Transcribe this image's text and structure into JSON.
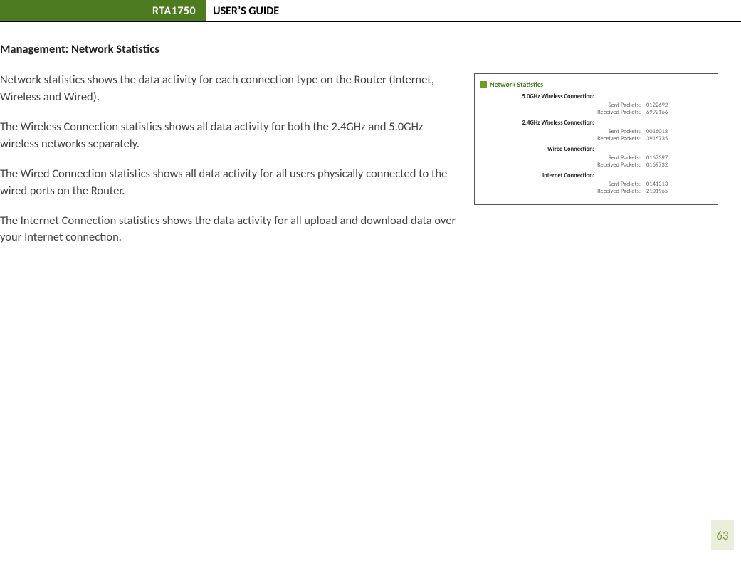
{
  "header": {
    "model": "RTA1750",
    "title": "USER’S GUIDE"
  },
  "section_heading": "Management: Network Statistics",
  "paragraphs": {
    "p1": "Network statistics shows the data activity for each connection type on the Router (Internet, Wireless and Wired).",
    "p2": "The Wireless Connection statistics shows all data activity for both the 2.4GHz and 5.0GHz wireless networks separately.",
    "p3": "The Wired Connection statistics shows all data activity for all users physically connected to the wired ports on the Router.",
    "p4": "The Internet Connection statistics shows the data activity for all upload and download data over your Internet connection."
  },
  "figure": {
    "title": "Network Statistics",
    "labels": {
      "sent": "Sent Packets:",
      "received": "Received Packets:"
    },
    "groups": [
      {
        "name": "5.0GHz Wireless Connection:",
        "sent": "0122692",
        "received": "6992166"
      },
      {
        "name": "2.4GHz Wireless Connection:",
        "sent": "0016018",
        "received": "3916735"
      },
      {
        "name": "Wired Connection:",
        "sent": "0167397",
        "received": "0169732"
      },
      {
        "name": "Internet Connection:",
        "sent": "0141313",
        "received": "2101965"
      }
    ]
  },
  "page_number": "63"
}
